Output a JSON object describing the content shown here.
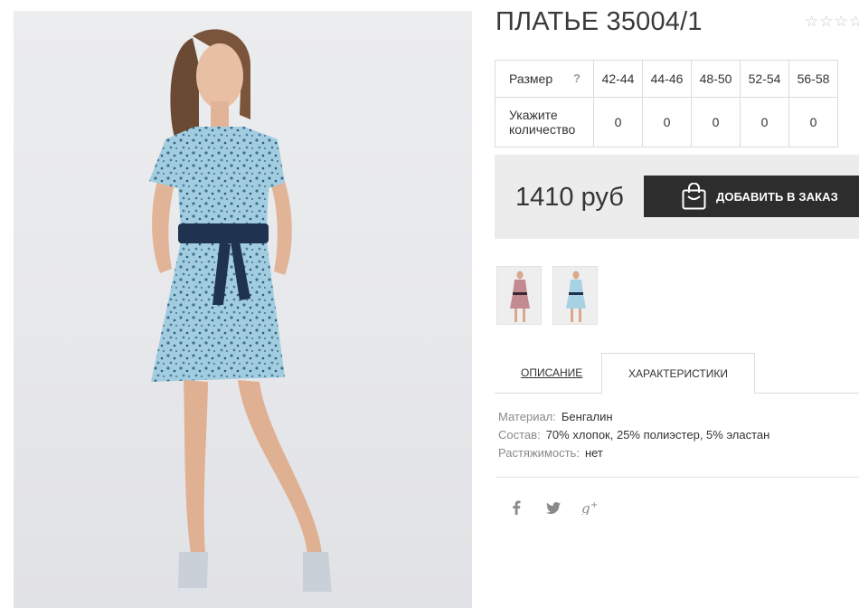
{
  "product": {
    "title": "ПЛАТЬЕ 35004/1",
    "rating_stars": "☆☆☆☆☆"
  },
  "size_table": {
    "size_label": "Размер",
    "help": "?",
    "qty_label": "Укажите количество",
    "sizes": [
      "42-44",
      "44-46",
      "48-50",
      "52-54",
      "56-58"
    ],
    "quantities": [
      "0",
      "0",
      "0",
      "0",
      "0"
    ]
  },
  "price": {
    "value": "1410 руб",
    "order_button": "ДОБАВИТЬ В ЗАКАЗ",
    "icon": "shopping-bag-icon"
  },
  "thumbnails": [
    {
      "name": "dress-pink-thumbnail"
    },
    {
      "name": "dress-blue-thumbnail"
    }
  ],
  "tabs": {
    "description": "ОПИСАНИЕ",
    "characteristics": "ХАРАКТЕРИСТИКИ"
  },
  "characteristics": [
    {
      "key": "Материал:",
      "value": "Бенгалин"
    },
    {
      "key": "Состав:",
      "value": "70% хлопок, 25% полиэстер, 5% эластан"
    },
    {
      "key": "Растяжимость:",
      "value": "нет"
    }
  ],
  "social": [
    "facebook-icon",
    "twitter-icon",
    "google-plus-icon"
  ],
  "colors": {
    "button_bg": "#2d2d2d",
    "price_box_bg": "#ececec",
    "dress": "#9fcce0",
    "belt": "#1f3250"
  }
}
